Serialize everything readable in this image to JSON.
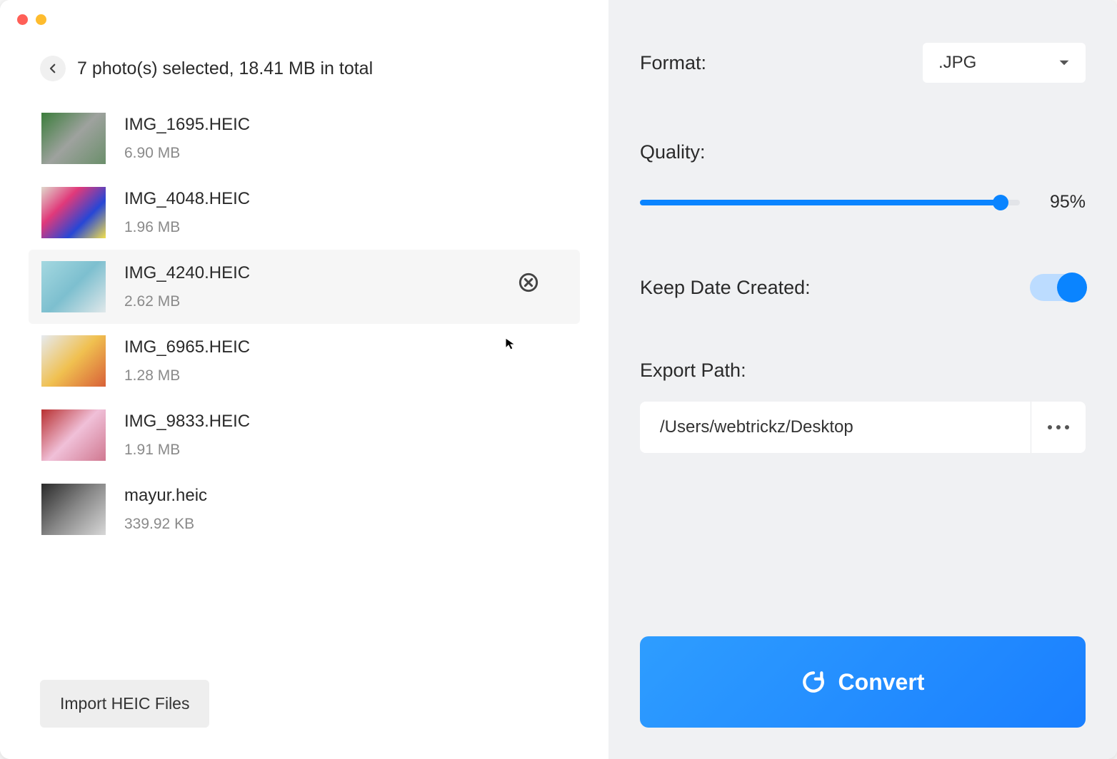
{
  "header": {
    "summary": "7 photo(s) selected, 18.41 MB in total"
  },
  "files": [
    {
      "name": "IMG_1695.HEIC",
      "size": "6.90 MB",
      "thumb_gradient": "linear-gradient(135deg,#3b7d3b,#9ea29e,#6b8f6b)"
    },
    {
      "name": "IMG_4048.HEIC",
      "size": "1.96 MB",
      "thumb_gradient": "linear-gradient(135deg,#e0d8cc,#e0397a,#2746d6,#f3e04b)"
    },
    {
      "name": "IMG_4240.HEIC",
      "size": "2.62 MB",
      "thumb_gradient": "linear-gradient(135deg,#a4d8e0,#7dbfcf,#e0e8ea)",
      "hovered": true
    },
    {
      "name": "IMG_6965.HEIC",
      "size": "1.28 MB",
      "thumb_gradient": "linear-gradient(135deg,#e6eaf0,#f0c050,#d86038)"
    },
    {
      "name": "IMG_9833.HEIC",
      "size": "1.91 MB",
      "thumb_gradient": "linear-gradient(135deg,#b83030,#f0c0d8,#d07890)"
    },
    {
      "name": "mayur.heic",
      "size": "339.92 KB",
      "thumb_gradient": "linear-gradient(135deg,#2a2a2a,#888888,#d8d8d8)"
    }
  ],
  "import_button": "Import HEIC Files",
  "settings": {
    "format_label": "Format:",
    "format_value": ".JPG",
    "quality_label": "Quality:",
    "quality_percent": 95,
    "quality_display": "95%",
    "keepdate_label": "Keep Date Created:",
    "keepdate_on": true,
    "exportpath_label": "Export Path:",
    "exportpath_value": "/Users/webtrickz/Desktop"
  },
  "convert_button": "Convert"
}
